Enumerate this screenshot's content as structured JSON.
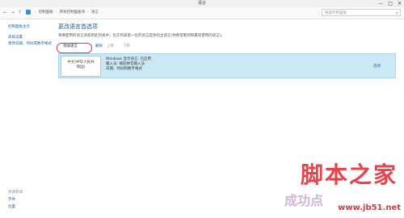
{
  "window": {
    "title": "语言",
    "controls": [
      "—",
      "□",
      "✕"
    ]
  },
  "address": {
    "back": "←",
    "forward": "→",
    "up": "↑",
    "breadcrumb": [
      "控制面板",
      "所有控制面板项",
      "语言"
    ],
    "search_placeholder": "搜索控制面板"
  },
  "sidebar": {
    "home_link": "控制面板主页",
    "links": [
      "高级设置",
      "更改日期、时间或数字格式"
    ],
    "see_also_heading": "另请参阅",
    "see_also": [
      "字体",
      "位置"
    ]
  },
  "main": {
    "title": "更改语言首选项",
    "description": "将要使用的语言添加到此列表中，位于列表第一位的语言是你的主语言(你希望看到和最常使用的语言)。",
    "toolbar": {
      "add": "添加语言",
      "remove": "删除",
      "up": "上移",
      "down": "下移"
    },
    "language": {
      "name_line1": "中文(中华人民共",
      "name_line2": "和国)",
      "details": [
        "Windows 显示语言: 已启用",
        "输入法: 微软拼音输入法",
        "日期、时间和数字格式"
      ],
      "options": "选项"
    }
  },
  "watermark": {
    "top": "脚本之家",
    "url": "www.jb51.net",
    "ghost": "成功点"
  }
}
